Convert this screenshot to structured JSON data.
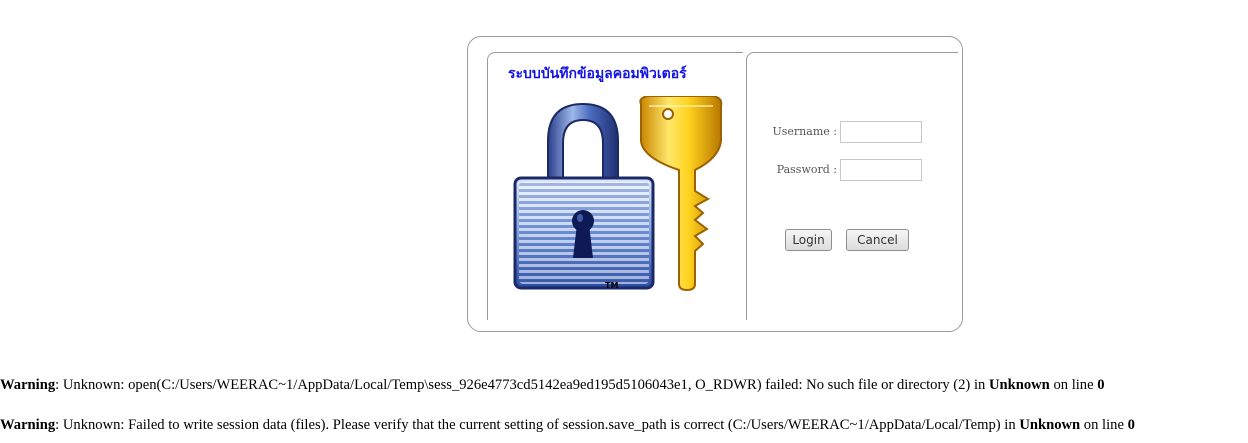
{
  "login": {
    "system_title": "ระบบบันทึกข้อมูลคอมพิวเตอร์",
    "trademark": "TM",
    "username_label": "Username",
    "password_label": "Password",
    "label_separator": ":",
    "username_value": "",
    "password_value": "",
    "login_button": "Login",
    "cancel_button": "Cancel"
  },
  "warnings": [
    {
      "prefix": "Warning",
      "message": ": Unknown: open(C:/Users/WEERAC~1/AppData/Local/Temp\\sess_926e4773cd5142ea9ed195d5106043e1, O_RDWR) failed: No such file or directory (2) in ",
      "location": "Unknown",
      "line_text": " on line ",
      "line_number": "0"
    },
    {
      "prefix": "Warning",
      "message": ": Unknown: Failed to write session data (files). Please verify that the current setting of session.save_path is correct (C:/Users/WEERAC~1/AppData/Local/Temp) in ",
      "location": "Unknown",
      "line_text": " on line ",
      "line_number": "0"
    }
  ],
  "icons": [
    "padlock-icon",
    "key-icon"
  ]
}
